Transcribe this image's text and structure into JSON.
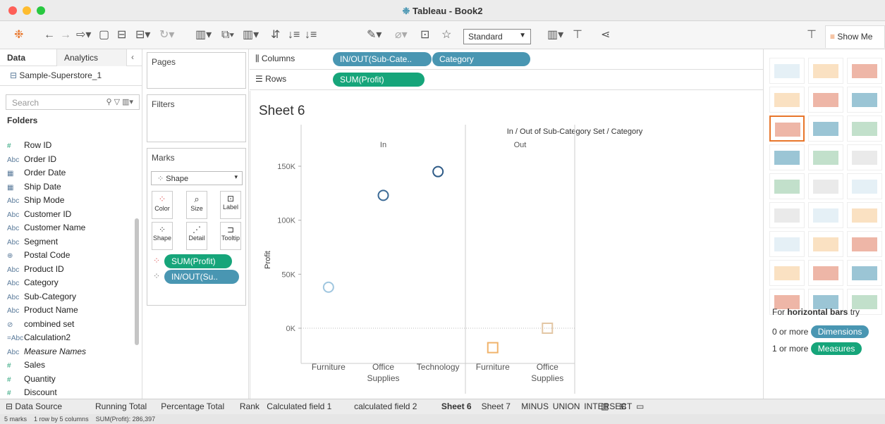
{
  "window": {
    "title": "Tableau - Book2",
    "title_color": "#333333"
  },
  "toolbar": {
    "view_size": "Standard",
    "show_me": "Show Me"
  },
  "data_pane": {
    "tab_data": "Data",
    "tab_analytics": "Analytics",
    "datasource": "Sample-Superstore_1",
    "search_placeholder": "Search",
    "folders_label": "Folders",
    "fields": [
      {
        "icon": "#",
        "name": "Row ID",
        "type": "measure"
      },
      {
        "icon": "Abc",
        "name": "Order ID",
        "type": "dimension"
      },
      {
        "icon": "▦",
        "name": "Order Date",
        "type": "date"
      },
      {
        "icon": "▦",
        "name": "Ship Date",
        "type": "date"
      },
      {
        "icon": "Abc",
        "name": "Ship Mode",
        "type": "dimension"
      },
      {
        "icon": "Abc",
        "name": "Customer ID",
        "type": "dimension"
      },
      {
        "icon": "Abc",
        "name": "Customer Name",
        "type": "dimension"
      },
      {
        "icon": "Abc",
        "name": "Segment",
        "type": "dimension"
      },
      {
        "icon": "⊕",
        "name": "Postal Code",
        "type": "geo"
      },
      {
        "icon": "Abc",
        "name": "Product ID",
        "type": "dimension"
      },
      {
        "icon": "Abc",
        "name": "Category",
        "type": "dimension"
      },
      {
        "icon": "Abc",
        "name": "Sub-Category",
        "type": "dimension"
      },
      {
        "icon": "Abc",
        "name": "Product Name",
        "type": "dimension"
      },
      {
        "icon": "⊘",
        "name": "combined set",
        "type": "set"
      },
      {
        "icon": "=Abc",
        "name": "Calculation2",
        "type": "calc"
      },
      {
        "icon": "Abc",
        "name": "Measure Names",
        "type": "dimension"
      },
      {
        "icon": "#",
        "name": "Sales",
        "type": "measure"
      },
      {
        "icon": "#",
        "name": "Quantity",
        "type": "measure"
      },
      {
        "icon": "#",
        "name": "Discount",
        "type": "measure"
      }
    ]
  },
  "cards": {
    "pages": "Pages",
    "filters": "Filters",
    "marks": "Marks",
    "mark_type": "Shape",
    "color": "Color",
    "size": "Size",
    "label": "Label",
    "shape": "Shape",
    "detail": "Detail",
    "tooltip": "Tooltip",
    "pill_profit": "SUM(Profit)",
    "pill_inout": "IN/OUT(Su.."
  },
  "shelves": {
    "columns_label": "Columns",
    "rows_label": "Rows",
    "col_pill1": "IN/OUT(Sub-Cate..",
    "col_pill2": "Category",
    "row_pill": "SUM(Profit)"
  },
  "sheet": {
    "title": "Sheet 6"
  },
  "chart_data": {
    "type": "scatter",
    "title": "In / Out of Sub-Category Set / Category",
    "ylabel": "Profit",
    "ylim": [
      -30000,
      165000
    ],
    "yticks": [
      {
        "v": 0,
        "t": "0K"
      },
      {
        "v": 50000,
        "t": "50K"
      },
      {
        "v": 100000,
        "t": "100K"
      },
      {
        "v": 150000,
        "t": "150K"
      }
    ],
    "panes": [
      {
        "name": "In",
        "categories": [
          "Furniture",
          "Office\nSupplies",
          "Technology"
        ],
        "values": [
          38000,
          123000,
          145000
        ]
      },
      {
        "name": "Out",
        "categories": [
          "Furniture",
          "Office\nSupplies"
        ],
        "values": [
          -18000,
          0
        ]
      }
    ],
    "colors": {
      "In": [
        "#9fc6df",
        "#3b6a96",
        "#2d5a86"
      ],
      "Out": [
        "#f0b36b",
        "#e3c7a5"
      ]
    }
  },
  "show_me": {
    "hint_prefix": "For ",
    "hint_bold": "horizontal bars",
    "hint_suffix": " try",
    "dims_pre": "0 or more",
    "dims_pill": "Dimensions",
    "meas_pre": "1 or more",
    "meas_pill": "Measures"
  },
  "sheet_tabs": {
    "data_source": "Data Source",
    "tabs": [
      "Running Total",
      "Percentage Total",
      "Rank",
      "Calculated field 1",
      "calculated field 2",
      "Sheet 6",
      "Sheet 7",
      "MINUS",
      "UNION",
      "INTERSECT"
    ],
    "active": "Sheet 6"
  },
  "status": {
    "marks": "5 marks",
    "dims": "1 row by 5 columns",
    "sum": "SUM(Profit): 286,397"
  }
}
